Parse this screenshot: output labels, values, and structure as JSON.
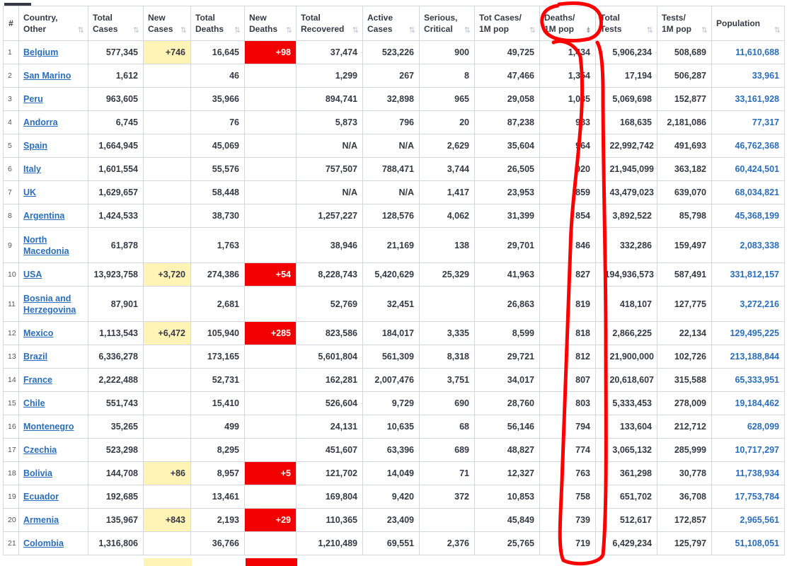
{
  "headers": [
    {
      "label": "#",
      "key": "rank"
    },
    {
      "label": "Country,\nOther",
      "key": "country"
    },
    {
      "label": "Total\nCases",
      "key": "total-cases"
    },
    {
      "label": "New\nCases",
      "key": "new-cases"
    },
    {
      "label": "Total\nDeaths",
      "key": "total-deaths"
    },
    {
      "label": "New\nDeaths",
      "key": "new-deaths"
    },
    {
      "label": "Total\nRecovered",
      "key": "total-recovered"
    },
    {
      "label": "Active\nCases",
      "key": "active-cases"
    },
    {
      "label": "Serious,\nCritical",
      "key": "serious-critical"
    },
    {
      "label": "Tot Cases/\n1M pop",
      "key": "tot-cases-per-1m"
    },
    {
      "label": "Deaths/\n1M pop",
      "key": "deaths-per-1m"
    },
    {
      "label": "Total\nTests",
      "key": "total-tests"
    },
    {
      "label": "Tests/\n1M pop",
      "key": "tests-per-1m"
    },
    {
      "label": "Population",
      "key": "population"
    }
  ],
  "sort": {
    "column": "deaths-per-1m",
    "direction": "descending"
  },
  "colors": {
    "new_cases_highlight": "#fff3b5",
    "new_deaths_highlight": "#f20000",
    "link": "#2a6ebb",
    "annotation": "#ff0000"
  },
  "icons": {
    "sort": "sort-arrows-icon",
    "sort_active": "sort-descending-icon"
  },
  "rows": [
    {
      "rank": "1",
      "country": "Belgium",
      "total_cases": "577,345",
      "new_cases": "+746",
      "total_deaths": "16,645",
      "new_deaths": "+98",
      "total_recovered": "37,474",
      "active_cases": "523,226",
      "serious_critical": "900",
      "tot_cases_1m": "49,725",
      "deaths_1m": "1,434",
      "total_tests": "5,906,234",
      "tests_1m": "508,689",
      "population": "11,610,688"
    },
    {
      "rank": "2",
      "country": "San Marino",
      "total_cases": "1,612",
      "new_cases": "",
      "total_deaths": "46",
      "new_deaths": "",
      "total_recovered": "1,299",
      "active_cases": "267",
      "serious_critical": "8",
      "tot_cases_1m": "47,466",
      "deaths_1m": "1,354",
      "total_tests": "17,194",
      "tests_1m": "506,287",
      "population": "33,961"
    },
    {
      "rank": "3",
      "country": "Peru",
      "total_cases": "963,605",
      "new_cases": "",
      "total_deaths": "35,966",
      "new_deaths": "",
      "total_recovered": "894,741",
      "active_cases": "32,898",
      "serious_critical": "965",
      "tot_cases_1m": "29,058",
      "deaths_1m": "1,085",
      "total_tests": "5,069,698",
      "tests_1m": "152,877",
      "population": "33,161,928"
    },
    {
      "rank": "4",
      "country": "Andorra",
      "total_cases": "6,745",
      "new_cases": "",
      "total_deaths": "76",
      "new_deaths": "",
      "total_recovered": "5,873",
      "active_cases": "796",
      "serious_critical": "20",
      "tot_cases_1m": "87,238",
      "deaths_1m": "983",
      "total_tests": "168,635",
      "tests_1m": "2,181,086",
      "population": "77,317"
    },
    {
      "rank": "5",
      "country": "Spain",
      "total_cases": "1,664,945",
      "new_cases": "",
      "total_deaths": "45,069",
      "new_deaths": "",
      "total_recovered": "N/A",
      "active_cases": "N/A",
      "serious_critical": "2,629",
      "tot_cases_1m": "35,604",
      "deaths_1m": "964",
      "total_tests": "22,992,742",
      "tests_1m": "491,693",
      "population": "46,762,368"
    },
    {
      "rank": "6",
      "country": "Italy",
      "total_cases": "1,601,554",
      "new_cases": "",
      "total_deaths": "55,576",
      "new_deaths": "",
      "total_recovered": "757,507",
      "active_cases": "788,471",
      "serious_critical": "3,744",
      "tot_cases_1m": "26,505",
      "deaths_1m": "920",
      "total_tests": "21,945,099",
      "tests_1m": "363,182",
      "population": "60,424,501"
    },
    {
      "rank": "7",
      "country": "UK",
      "total_cases": "1,629,657",
      "new_cases": "",
      "total_deaths": "58,448",
      "new_deaths": "",
      "total_recovered": "N/A",
      "active_cases": "N/A",
      "serious_critical": "1,417",
      "tot_cases_1m": "23,953",
      "deaths_1m": "859",
      "total_tests": "43,479,023",
      "tests_1m": "639,070",
      "population": "68,034,821"
    },
    {
      "rank": "8",
      "country": "Argentina",
      "total_cases": "1,424,533",
      "new_cases": "",
      "total_deaths": "38,730",
      "new_deaths": "",
      "total_recovered": "1,257,227",
      "active_cases": "128,576",
      "serious_critical": "4,062",
      "tot_cases_1m": "31,399",
      "deaths_1m": "854",
      "total_tests": "3,892,522",
      "tests_1m": "85,798",
      "population": "45,368,199"
    },
    {
      "rank": "9",
      "country": "North Macedonia",
      "total_cases": "61,878",
      "new_cases": "",
      "total_deaths": "1,763",
      "new_deaths": "",
      "total_recovered": "38,946",
      "active_cases": "21,169",
      "serious_critical": "138",
      "tot_cases_1m": "29,701",
      "deaths_1m": "846",
      "total_tests": "332,286",
      "tests_1m": "159,497",
      "population": "2,083,338"
    },
    {
      "rank": "10",
      "country": "USA",
      "total_cases": "13,923,758",
      "new_cases": "+3,720",
      "total_deaths": "274,386",
      "new_deaths": "+54",
      "total_recovered": "8,228,743",
      "active_cases": "5,420,629",
      "serious_critical": "25,329",
      "tot_cases_1m": "41,963",
      "deaths_1m": "827",
      "total_tests": "194,936,573",
      "tests_1m": "587,491",
      "population": "331,812,157"
    },
    {
      "rank": "11",
      "country": "Bosnia and Herzegovina",
      "total_cases": "87,901",
      "new_cases": "",
      "total_deaths": "2,681",
      "new_deaths": "",
      "total_recovered": "52,769",
      "active_cases": "32,451",
      "serious_critical": "",
      "tot_cases_1m": "26,863",
      "deaths_1m": "819",
      "total_tests": "418,107",
      "tests_1m": "127,775",
      "population": "3,272,216"
    },
    {
      "rank": "12",
      "country": "Mexico",
      "total_cases": "1,113,543",
      "new_cases": "+6,472",
      "total_deaths": "105,940",
      "new_deaths": "+285",
      "total_recovered": "823,586",
      "active_cases": "184,017",
      "serious_critical": "3,335",
      "tot_cases_1m": "8,599",
      "deaths_1m": "818",
      "total_tests": "2,866,225",
      "tests_1m": "22,134",
      "population": "129,495,225"
    },
    {
      "rank": "13",
      "country": "Brazil",
      "total_cases": "6,336,278",
      "new_cases": "",
      "total_deaths": "173,165",
      "new_deaths": "",
      "total_recovered": "5,601,804",
      "active_cases": "561,309",
      "serious_critical": "8,318",
      "tot_cases_1m": "29,721",
      "deaths_1m": "812",
      "total_tests": "21,900,000",
      "tests_1m": "102,726",
      "population": "213,188,844"
    },
    {
      "rank": "14",
      "country": "France",
      "total_cases": "2,222,488",
      "new_cases": "",
      "total_deaths": "52,731",
      "new_deaths": "",
      "total_recovered": "162,281",
      "active_cases": "2,007,476",
      "serious_critical": "3,751",
      "tot_cases_1m": "34,017",
      "deaths_1m": "807",
      "total_tests": "20,618,607",
      "tests_1m": "315,588",
      "population": "65,333,951"
    },
    {
      "rank": "15",
      "country": "Chile",
      "total_cases": "551,743",
      "new_cases": "",
      "total_deaths": "15,410",
      "new_deaths": "",
      "total_recovered": "526,604",
      "active_cases": "9,729",
      "serious_critical": "690",
      "tot_cases_1m": "28,760",
      "deaths_1m": "803",
      "total_tests": "5,333,453",
      "tests_1m": "278,009",
      "population": "19,184,462"
    },
    {
      "rank": "16",
      "country": "Montenegro",
      "total_cases": "35,265",
      "new_cases": "",
      "total_deaths": "499",
      "new_deaths": "",
      "total_recovered": "24,131",
      "active_cases": "10,635",
      "serious_critical": "68",
      "tot_cases_1m": "56,146",
      "deaths_1m": "794",
      "total_tests": "133,604",
      "tests_1m": "212,712",
      "population": "628,099"
    },
    {
      "rank": "17",
      "country": "Czechia",
      "total_cases": "523,298",
      "new_cases": "",
      "total_deaths": "8,295",
      "new_deaths": "",
      "total_recovered": "451,607",
      "active_cases": "63,396",
      "serious_critical": "689",
      "tot_cases_1m": "48,827",
      "deaths_1m": "774",
      "total_tests": "3,065,132",
      "tests_1m": "285,999",
      "population": "10,717,297"
    },
    {
      "rank": "18",
      "country": "Bolivia",
      "total_cases": "144,708",
      "new_cases": "+86",
      "total_deaths": "8,957",
      "new_deaths": "+5",
      "total_recovered": "121,702",
      "active_cases": "14,049",
      "serious_critical": "71",
      "tot_cases_1m": "12,327",
      "deaths_1m": "763",
      "total_tests": "361,298",
      "tests_1m": "30,778",
      "population": "11,738,934"
    },
    {
      "rank": "19",
      "country": "Ecuador",
      "total_cases": "192,685",
      "new_cases": "",
      "total_deaths": "13,461",
      "new_deaths": "",
      "total_recovered": "169,804",
      "active_cases": "9,420",
      "serious_critical": "372",
      "tot_cases_1m": "10,853",
      "deaths_1m": "758",
      "total_tests": "651,702",
      "tests_1m": "36,708",
      "population": "17,753,784"
    },
    {
      "rank": "20",
      "country": "Armenia",
      "total_cases": "135,967",
      "new_cases": "+843",
      "total_deaths": "2,193",
      "new_deaths": "+29",
      "total_recovered": "110,365",
      "active_cases": "23,409",
      "serious_critical": "",
      "tot_cases_1m": "45,849",
      "deaths_1m": "739",
      "total_tests": "512,617",
      "tests_1m": "172,857",
      "population": "2,965,561"
    },
    {
      "rank": "21",
      "country": "Colombia",
      "total_cases": "1,316,806",
      "new_cases": "",
      "total_deaths": "36,766",
      "new_deaths": "",
      "total_recovered": "1,210,489",
      "active_cases": "69,551",
      "serious_critical": "2,376",
      "tot_cases_1m": "25,765",
      "deaths_1m": "719",
      "total_tests": "6,429,234",
      "tests_1m": "125,797",
      "population": "51,108,051"
    }
  ]
}
